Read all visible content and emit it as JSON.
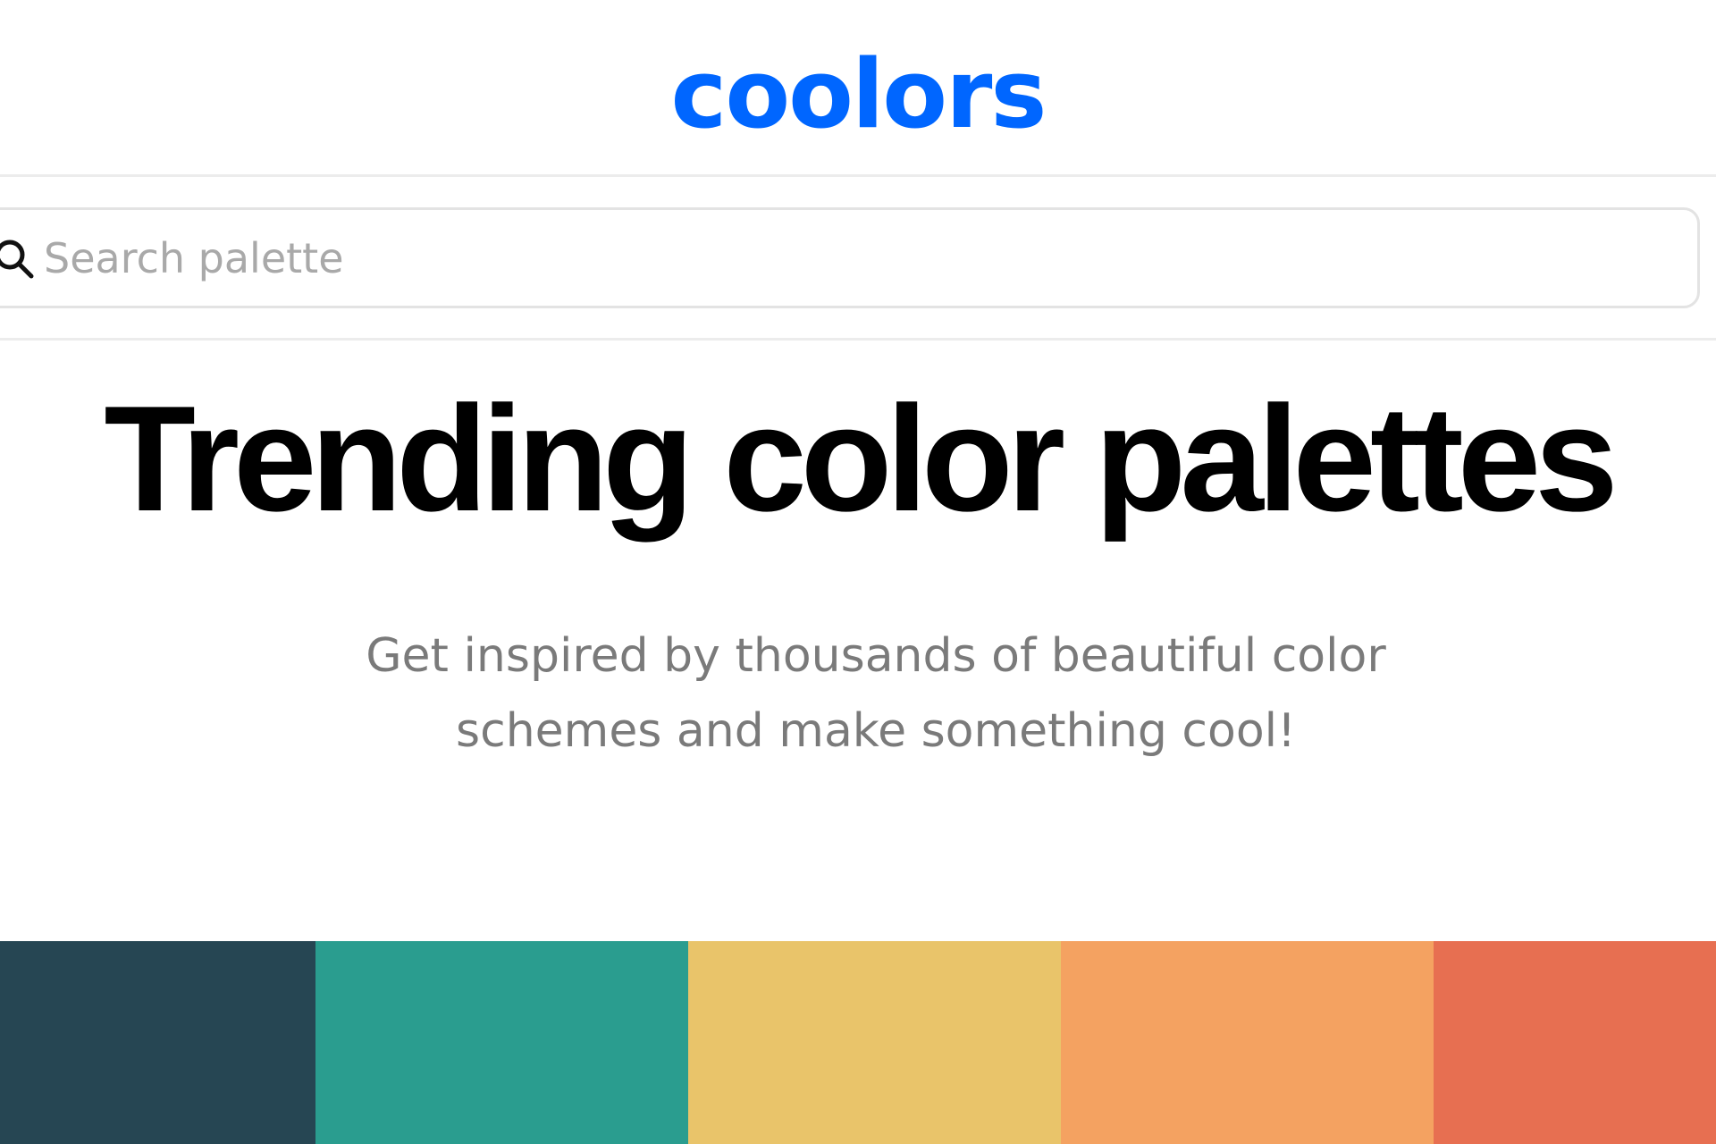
{
  "header": {
    "logo_text": "coolors",
    "brand_color": "#0066ff"
  },
  "search": {
    "icon": "search-icon",
    "placeholder": "Search palette",
    "value": ""
  },
  "hero": {
    "title": "Trending color palettes",
    "subtitle": "Get inspired by thousands of beautiful color schemes and make something cool!"
  },
  "palette": {
    "swatches": [
      {
        "color": "#264653"
      },
      {
        "color": "#2a9d8f"
      },
      {
        "color": "#e9c46a"
      },
      {
        "color": "#f4a261"
      },
      {
        "color": "#e76f51"
      }
    ]
  }
}
